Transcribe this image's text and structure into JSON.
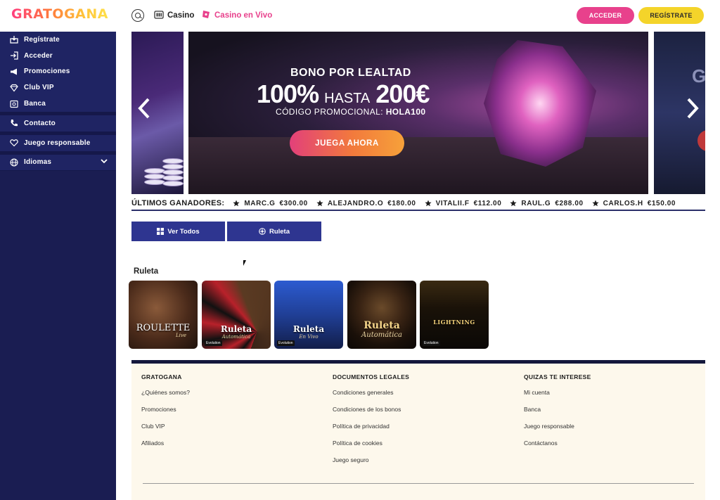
{
  "header": {
    "logo": "GRATOGANA",
    "nav": [
      {
        "label": "Casino"
      },
      {
        "label": "Casino en Vivo"
      }
    ],
    "login_label": "ACCEDER",
    "register_label": "REGÍSTRATE",
    "colors": {
      "accent_pink": "#e8418c",
      "accent_yellow": "#f4d42a"
    }
  },
  "sidebar": {
    "items": [
      {
        "label": "Regístrate",
        "icon": "register-icon"
      },
      {
        "label": "Acceder",
        "icon": "login-icon"
      },
      {
        "label": "Promociones",
        "icon": "megaphone-icon"
      },
      {
        "label": "Club VIP",
        "icon": "diamond-icon"
      },
      {
        "label": "Banca",
        "icon": "bank-icon"
      },
      {
        "label": "Contacto",
        "icon": "phone-icon"
      },
      {
        "label": "Juego responsable",
        "icon": "heart-icon"
      },
      {
        "label": "Idiomas",
        "icon": "globe-icon"
      }
    ],
    "colors": {
      "bg": "#1a1d52"
    }
  },
  "hero": {
    "title": "BONO POR LEALTAD",
    "percent": "100%",
    "upto": "HASTA",
    "amount": "200€",
    "code_label": "CÓDIGO PROMOCIONAL:",
    "code": "HOLA100",
    "cta": "JUEGA AHORA",
    "right_peek_letter": "G"
  },
  "winners": {
    "label": "ÚLTIMOS GANADORES:",
    "entries": [
      {
        "name": "MARC.G",
        "amount": "€300.00"
      },
      {
        "name": "ALEJANDRO.O",
        "amount": "€180.00"
      },
      {
        "name": "VITALII.F",
        "amount": "€112.00"
      },
      {
        "name": "RAUL.G",
        "amount": "€288.00"
      },
      {
        "name": "CARLOS.H",
        "amount": "€150.00"
      }
    ]
  },
  "tabs": [
    {
      "label": "Ver Todos"
    },
    {
      "label": "Ruleta"
    }
  ],
  "games_section": {
    "title": "Ruleta",
    "games": [
      {
        "name": "ROULETTE",
        "subtitle": "Live"
      },
      {
        "name": "Ruleta",
        "subtitle": "Automática",
        "badge": "Evolution"
      },
      {
        "name": "Ruleta",
        "subtitle": "En Vivo",
        "badge": "Evolution"
      },
      {
        "name": "Ruleta",
        "subtitle": "Automática"
      },
      {
        "name": "LIGHTNING",
        "subtitle": "",
        "badge": "Evolution"
      }
    ]
  },
  "footer": {
    "columns": [
      {
        "title": "GRATOGANA",
        "links": [
          "¿Quiénes somos?",
          "Promociones",
          "Club VIP",
          "Afiliados"
        ]
      },
      {
        "title": "DOCUMENTOS LEGALES",
        "links": [
          "Condiciones generales",
          "Condiciones de los bonos",
          "Política de privacidad",
          "Política de cookies",
          "Juego seguro"
        ]
      },
      {
        "title": "QUIZAS TE INTERESE",
        "links": [
          "Mi cuenta",
          "Banca",
          "Juego responsable",
          "Contáctanos"
        ]
      }
    ]
  }
}
